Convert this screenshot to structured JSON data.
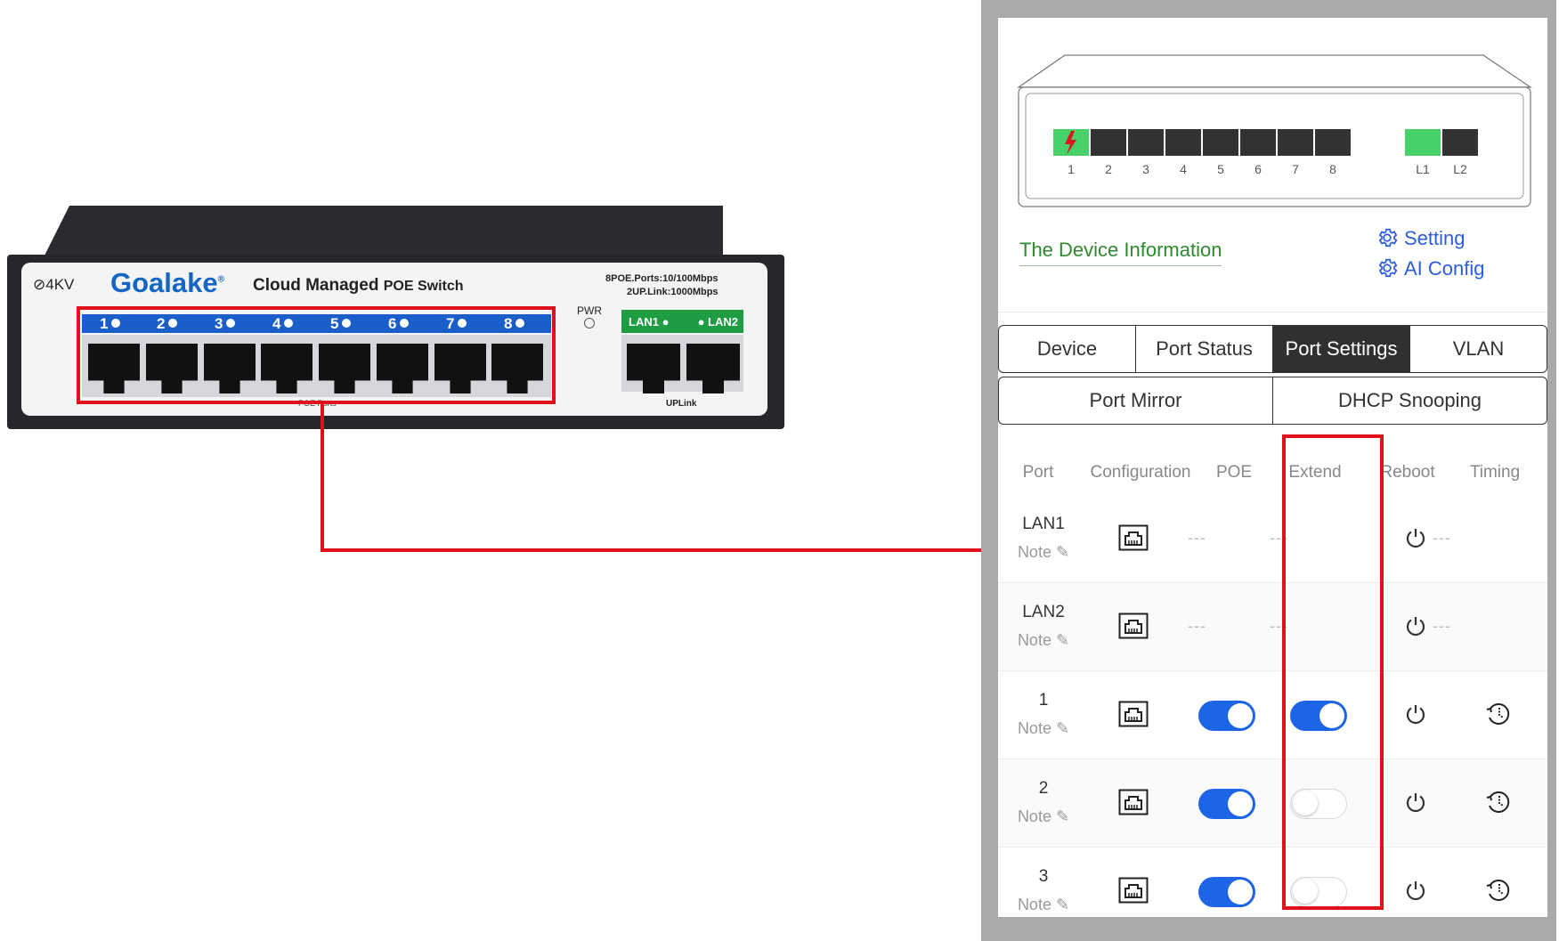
{
  "switch": {
    "surge": "4KV",
    "brand": "Goalake",
    "model_prefix": "Cloud Managed",
    "model_suffix": "POE Switch",
    "spec_line1": "8POE.Ports:10/100Mbps",
    "spec_line2": "2UP.Link:1000Mbps",
    "pwr_label": "PWR",
    "poe_ports": [
      "1",
      "2",
      "3",
      "4",
      "5",
      "6",
      "7",
      "8"
    ],
    "uplink_ports": [
      "LAN1",
      "LAN2"
    ],
    "poe_ports_label": "POE Ports",
    "uplink_label": "UPLink"
  },
  "device_illustration": {
    "ports": [
      "1",
      "2",
      "3",
      "4",
      "5",
      "6",
      "7",
      "8"
    ],
    "uplinks": [
      "L1",
      "L2"
    ]
  },
  "app": {
    "device_info_link": "The Device Information",
    "setting_link": "Setting",
    "ai_config_link": "AI Config",
    "tabs_row1": [
      "Device",
      "Port Status",
      "Port Settings",
      "VLAN"
    ],
    "tabs_row2": [
      "Port Mirror",
      "DHCP Snooping"
    ],
    "active_tab": "Port Settings",
    "columns": [
      "Port",
      "Configuration",
      "POE",
      "Extend",
      "Reboot",
      "Timing"
    ],
    "rows": [
      {
        "port": "LAN1",
        "note": "Note",
        "poe": "---",
        "extend": "---",
        "timing": "---"
      },
      {
        "port": "LAN2",
        "note": "Note",
        "poe": "---",
        "extend": "---",
        "timing": "---"
      },
      {
        "port": "1",
        "note": "Note",
        "poe": "on",
        "extend": "on",
        "timing": "icon"
      },
      {
        "port": "2",
        "note": "Note",
        "poe": "on",
        "extend": "off",
        "timing": "icon"
      },
      {
        "port": "3",
        "note": "Note",
        "poe": "on",
        "extend": "off",
        "timing": "icon"
      }
    ]
  },
  "colors": {
    "highlight": "#e0101d",
    "toggle_on": "#1d65e6",
    "link_green": "#2f8a2f",
    "link_blue": "#2b5de0",
    "port_active": "#47d16b"
  }
}
